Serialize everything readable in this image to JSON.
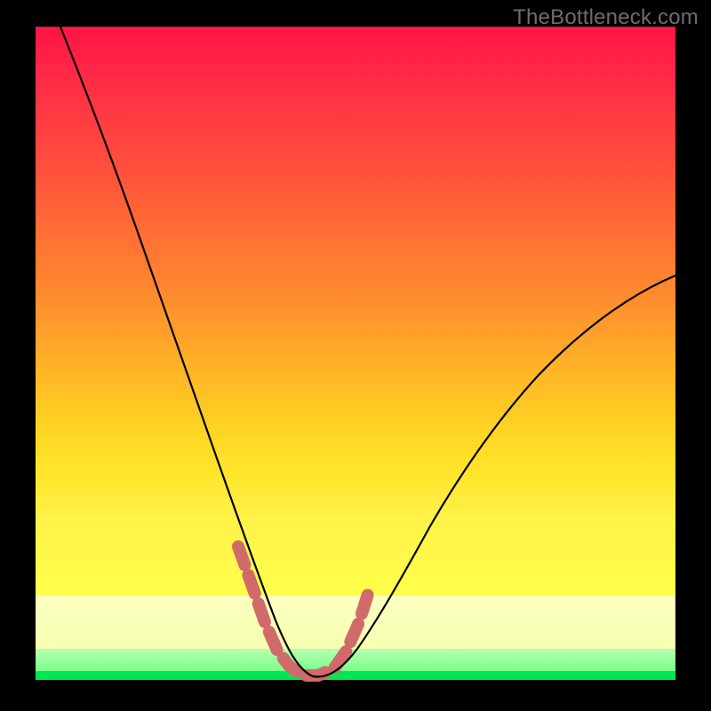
{
  "watermark": "TheBottleneck.com",
  "chart_data": {
    "type": "line",
    "title": "",
    "xlabel": "",
    "ylabel": "",
    "xlim": [
      0,
      100
    ],
    "ylim": [
      0,
      100
    ],
    "grid": false,
    "legend": false,
    "series": [
      {
        "name": "bottleneck-curve",
        "color": "#000000",
        "x": [
          4,
          8,
          12,
          16,
          20,
          24,
          28,
          32,
          34,
          36,
          38,
          40,
          42,
          44,
          48,
          52,
          56,
          60,
          66,
          74,
          82,
          90,
          100
        ],
        "y": [
          100,
          89,
          78,
          67,
          56,
          45,
          35,
          22,
          16,
          10,
          5,
          1,
          0,
          0,
          1,
          5,
          10,
          16,
          24,
          34,
          44,
          52,
          62
        ]
      },
      {
        "name": "highlight-region",
        "color": "#d16a6a",
        "style": "dashed-thick",
        "x": [
          32,
          34,
          36,
          38,
          40,
          42,
          44,
          46,
          48,
          50,
          52
        ],
        "y": [
          20,
          14,
          8,
          4,
          1,
          0,
          0,
          0,
          1,
          4,
          9
        ]
      }
    ],
    "background_gradient_stops": [
      {
        "pos": 0.0,
        "color": "#ff1444"
      },
      {
        "pos": 0.26,
        "color": "#ff4a3e"
      },
      {
        "pos": 0.55,
        "color": "#ff8c2e"
      },
      {
        "pos": 0.78,
        "color": "#ffe52a"
      },
      {
        "pos": 0.86,
        "color": "#fcffc0"
      },
      {
        "pos": 0.95,
        "color": "#b6ffb0"
      },
      {
        "pos": 1.0,
        "color": "#00e756"
      }
    ]
  }
}
